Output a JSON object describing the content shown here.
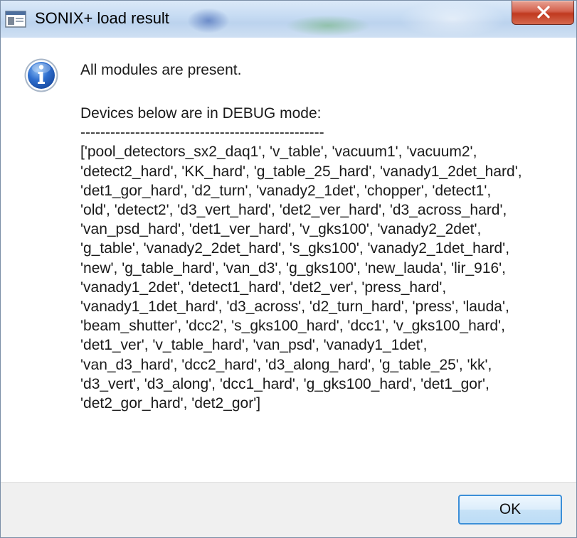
{
  "window": {
    "title": "SONIX+ load result",
    "close_glyph": "X"
  },
  "dialog": {
    "icon": "info-icon",
    "message": "All modules are present.",
    "debug_header": "Devices below are in DEBUG mode:",
    "separator": "-------------------------------------------------",
    "device_lines": [
      "['pool_detectors_sx2_daq1', 'v_table', 'vacuum1', 'vacuum2',",
      "'detect2_hard', 'KK_hard', 'g_table_25_hard', 'vanady1_2det_hard',",
      "'det1_gor_hard', 'd2_turn', 'vanady2_1det', 'chopper', 'detect1',",
      "'old', 'detect2', 'd3_vert_hard', 'det2_ver_hard', 'd3_across_hard',",
      "'van_psd_hard', 'det1_ver_hard', 'v_gks100', 'vanady2_2det',",
      "'g_table', 'vanady2_2det_hard', 's_gks100', 'vanady2_1det_hard',",
      "'new', 'g_table_hard', 'van_d3', 'g_gks100', 'new_lauda', 'lir_916',",
      "'vanady1_2det', 'detect1_hard', 'det2_ver', 'press_hard',",
      "'vanady1_1det_hard', 'd3_across', 'd2_turn_hard', 'press', 'lauda',",
      "'beam_shutter', 'dcc2', 's_gks100_hard', 'dcc1', 'v_gks100_hard',",
      "'det1_ver', 'v_table_hard', 'van_psd', 'vanady1_1det',",
      "'van_d3_hard', 'dcc2_hard', 'd3_along_hard', 'g_table_25', 'kk',",
      "'d3_vert', 'd3_along', 'dcc1_hard', 'g_gks100_hard', 'det1_gor',",
      "'det2_gor_hard', 'det2_gor']"
    ]
  },
  "footer": {
    "ok_label": "OK"
  },
  "colors": {
    "titlebar": "#c7dcf3",
    "close_button": "#c0391f",
    "info_icon": "#2a67c4",
    "footer": "#f0f0f0",
    "ok_border": "#3c8fd8"
  }
}
